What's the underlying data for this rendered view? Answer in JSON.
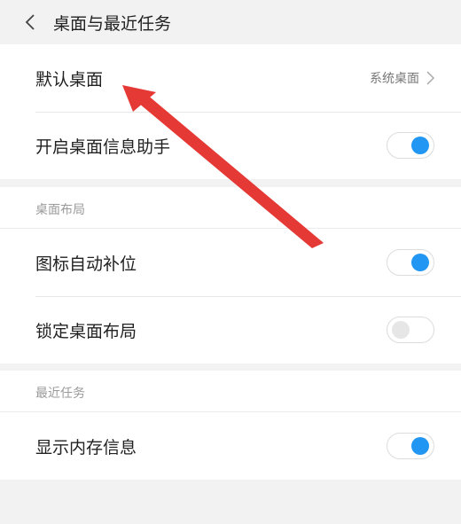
{
  "header": {
    "title": "桌面与最近任务"
  },
  "rows": {
    "default_desktop": {
      "label": "默认桌面",
      "value": "系统桌面"
    },
    "desktop_info": {
      "label": "开启桌面信息助手",
      "toggle": true
    }
  },
  "section_layout": {
    "title": "桌面布局",
    "auto_fill": {
      "label": "图标自动补位",
      "toggle": true
    },
    "lock_layout": {
      "label": "锁定桌面布局",
      "toggle": false
    }
  },
  "section_recent": {
    "title": "最近任务",
    "memory_info": {
      "label": "显示内存信息",
      "toggle": true
    }
  },
  "colors": {
    "accent": "#2196f3",
    "annotation": "#e53935"
  }
}
